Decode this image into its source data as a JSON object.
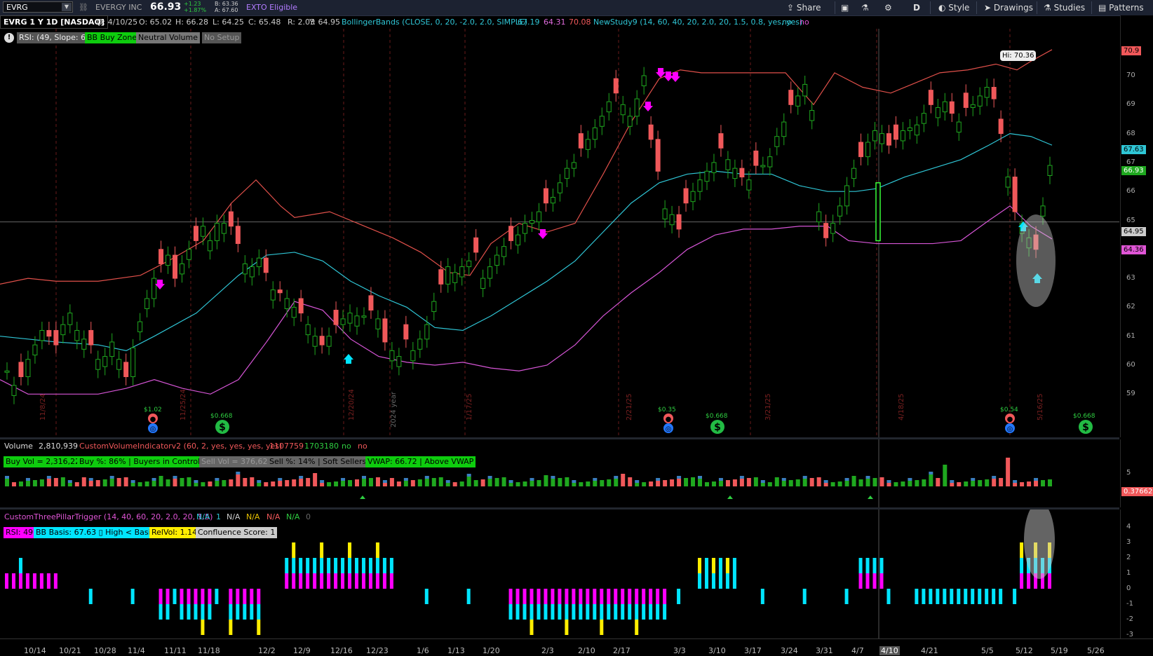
{
  "toolbar": {
    "symbol": "EVRG",
    "company": "EVERGY INC",
    "last": "66.93",
    "chg_up": "+1.23",
    "chg_pct": "+1.87%",
    "bid": "B: 63.36",
    "ask": "A: 67.60",
    "exto": "EXTO Eligible",
    "share": "Share",
    "style": "Style",
    "drawings": "Drawings",
    "studies": "Studies",
    "patterns": "Patterns",
    "period": "D"
  },
  "info": {
    "title": "EVRG 1 Y 1D [NASDAQ]",
    "date": "D: 4/10/25",
    "open": "O: 65.02",
    "high": "H: 66.28",
    "low": "L: 64.25",
    "close": "C: 65.48",
    "range": "R: 2.03",
    "y": "Y: 64.95",
    "bb": "BollingerBands (CLOSE, 0, 20, -2.0, 2.0, SIMPLE)",
    "bb_mid": "67.19",
    "bb_low": "64.31",
    "bb_up": "70.08",
    "ns": "NewStudy9 (14, 60, 40, 20, 2.0, 20, 1.5, 0.8, yes, yes)",
    "ns_no1": "no",
    "ns_no2": "no"
  },
  "price_badges": [
    "RSI: (49, Slope: 6)",
    "BB Buy Zone",
    "Neutral Volume",
    "No Setup"
  ],
  "price_axis": [
    "70",
    "69",
    "68",
    "67",
    "66",
    "65",
    "64",
    "63",
    "62",
    "61",
    "60",
    "59"
  ],
  "price_tags": {
    "top": "70.9",
    "mid": "67.63",
    "last": "66.93",
    "cursor": "64.95",
    "low": "64.36"
  },
  "hi_label": "Hi: 70.36",
  "dividends": [
    "$0.668",
    "$0.668",
    "$0.668",
    "$0.668"
  ],
  "earnings": [
    "$1.02",
    "$0.35",
    "$0.54"
  ],
  "date_markers": [
    "11/8/24",
    "11/25/24",
    "12/20/24",
    "2024 year",
    "1/17/25",
    "2/21/25",
    "3/21/25",
    "4/18/25",
    "5/16/25"
  ],
  "volume": {
    "label": "Volume",
    "value": "2,810,939",
    "cvi": "CustomVolumeIndicatorv2 (60, 2, yes, yes, yes, yes)",
    "v1": "1107759",
    "v2": "1703180",
    "no1": "no",
    "no2": "no",
    "badges": [
      "Buy Vol = 2,316,228",
      "Buy %: 86% | Buyers in Control",
      "Sell Vol = 376,623",
      "Sell %: 14% | Soft Sellers",
      "VWAP: 66.72 | Above VWAP"
    ],
    "axis": "5",
    "tag": "0.37662"
  },
  "pillar": {
    "label": "CustomThreePillarTrigger (14, 40, 60, 20, 2.0, 20, 1.5)",
    "vals": [
      "N/A",
      "1",
      "N/A",
      "N/A",
      "N/A",
      "N/A",
      "0"
    ],
    "badges": [
      "RSI: 49",
      "BB Basis: 67.63 ▯ High < Basis",
      "RelVol: 1.14",
      "Confluence Score: 1"
    ],
    "axis": [
      "4",
      "3",
      "2",
      "1",
      "0",
      "-1",
      "-2",
      "-3"
    ]
  },
  "x_axis": [
    "10/14",
    "10/21",
    "10/28",
    "11/4",
    "11/11",
    "11/18",
    "12/2",
    "12/9",
    "12/16",
    "12/23",
    "1/6",
    "1/13",
    "1/20",
    "2/3",
    "2/10",
    "2/17",
    "3/3",
    "3/10",
    "3/17",
    "3/24",
    "3/31",
    "4/7",
    "4/10",
    "4/21",
    "5/5",
    "5/12",
    "5/19",
    "5/26"
  ],
  "colors": {
    "up": "#1fa81f",
    "down": "#f0585a",
    "bb_up": "#e0504a",
    "bb_mid": "#2fc6d6",
    "bb_low": "#d655d6",
    "cyan": "#00e5ff",
    "magenta": "#ff00ff",
    "yellow": "#ffee00"
  }
}
